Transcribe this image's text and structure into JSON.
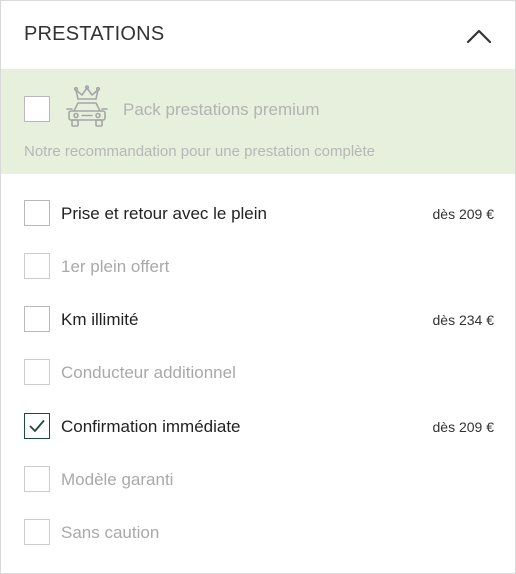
{
  "header": {
    "title": "PRESTATIONS",
    "collapse_icon": "chevron-up-icon"
  },
  "premium": {
    "label": "Pack prestations premium",
    "note": "Notre recommandation pour une prestation complète",
    "icon": "crowned-car-icon",
    "checked": false
  },
  "options": [
    {
      "label": "Prise et retour avec le plein",
      "price": "dès 209 €",
      "checked": false,
      "enabled": true
    },
    {
      "label": "1er plein offert",
      "price": "",
      "checked": false,
      "enabled": false
    },
    {
      "label": "Km illimité",
      "price": "dès 234 €",
      "checked": false,
      "enabled": true
    },
    {
      "label": "Conducteur additionnel",
      "price": "",
      "checked": false,
      "enabled": false
    },
    {
      "label": "Confirmation immédiate",
      "price": "dès 209 €",
      "checked": true,
      "enabled": true
    },
    {
      "label": "Modèle garanti",
      "price": "",
      "checked": false,
      "enabled": false
    },
    {
      "label": "Sans caution",
      "price": "",
      "checked": false,
      "enabled": false
    }
  ],
  "colors": {
    "premium_bg": "#e6f0dc",
    "check": "#1f4b38",
    "disabled_text": "#a9a9a9"
  }
}
